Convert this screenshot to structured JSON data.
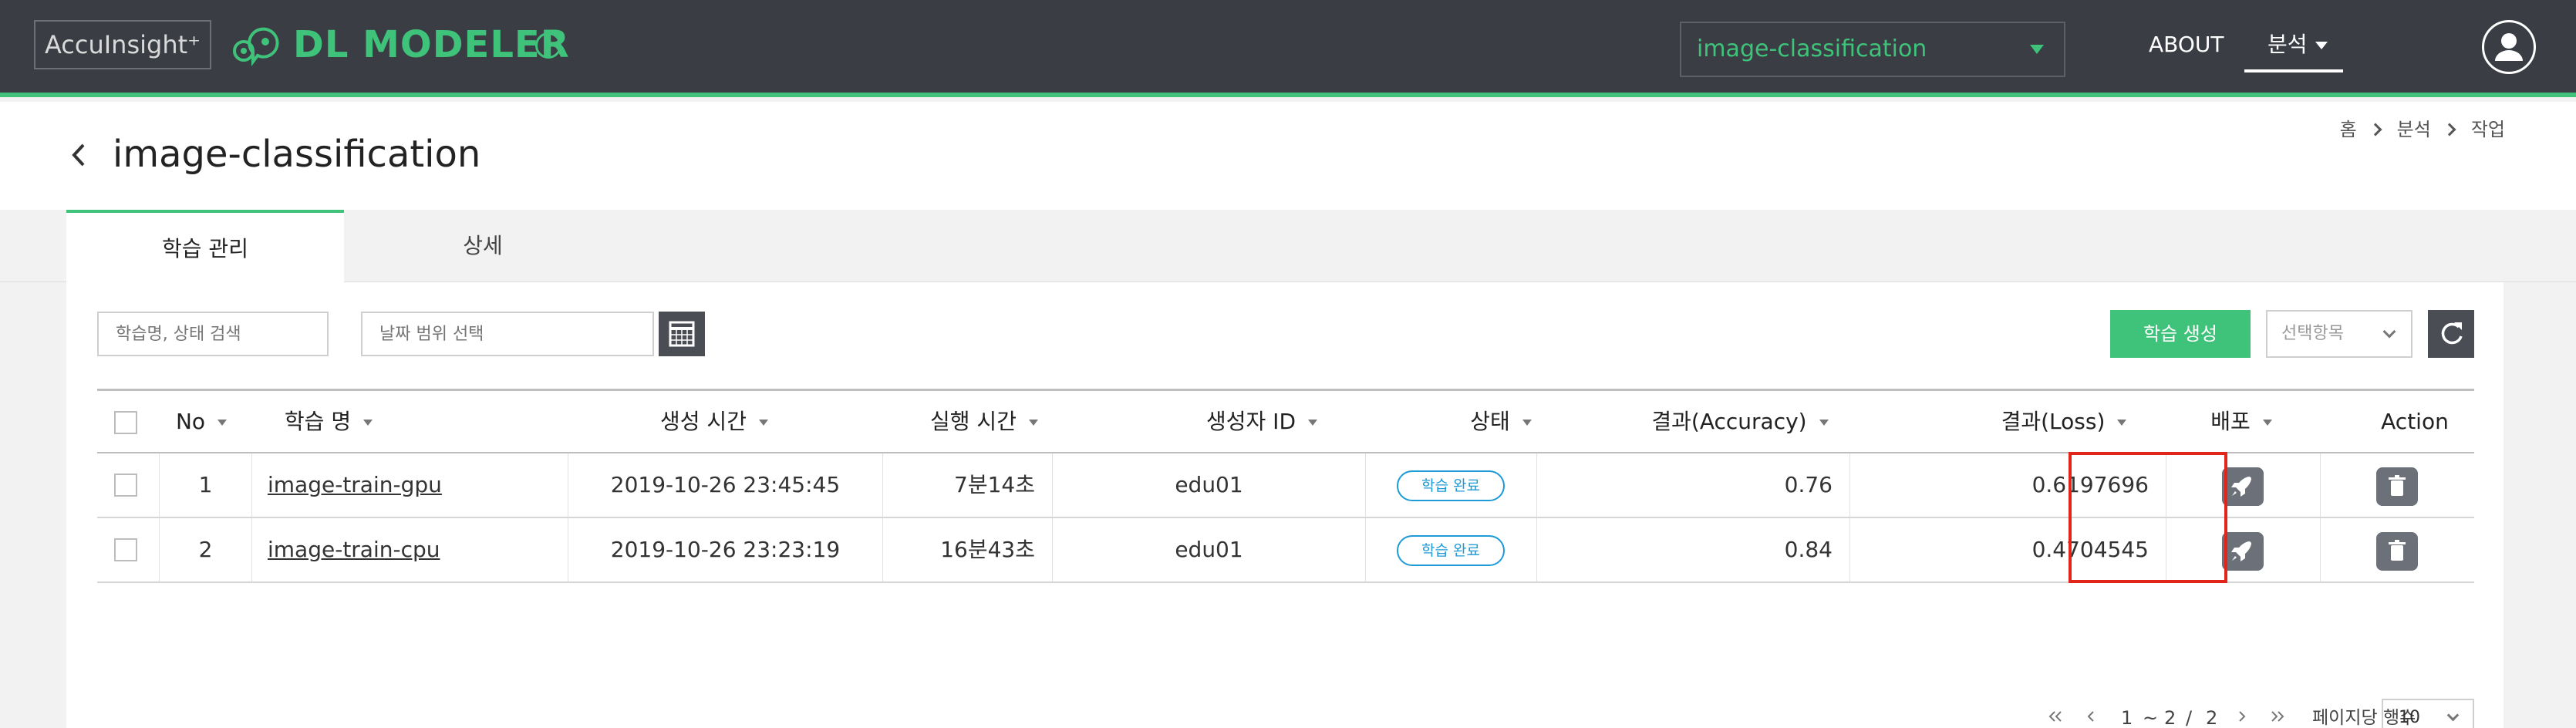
{
  "header": {
    "brand": "AccuInsight⁺",
    "product_name": "DL MODELER",
    "project_select": "image-classification",
    "nav_about": "ABOUT",
    "nav_analysis": "분석"
  },
  "titlebar": {
    "title": "image-classification",
    "breadcrumb": [
      "홈",
      "분석",
      "작업"
    ]
  },
  "tabs": [
    {
      "label": "학습 관리",
      "active": true
    },
    {
      "label": "상세",
      "active": false
    }
  ],
  "toolbar": {
    "search_placeholder": "학습명, 상태 검색",
    "date_placeholder": "날짜 범위 선택",
    "create_label": "학습 생성",
    "select_items_label": "선택항목"
  },
  "table": {
    "headers": {
      "no": "No",
      "name": "학습 명",
      "created": "생성 시간",
      "runtime": "실행 시간",
      "creator": "생성자 ID",
      "status": "상태",
      "accuracy": "결과(Accuracy)",
      "loss": "결과(Loss)",
      "deploy": "배포",
      "action": "Action"
    },
    "rows": [
      {
        "no": "1",
        "name": "image-train-gpu",
        "created": "2019-10-26 23:45:45",
        "runtime": "7분14초",
        "creator": "edu01",
        "status": "학습 완료",
        "accuracy": "0.76",
        "loss": "0.6197696"
      },
      {
        "no": "2",
        "name": "image-train-cpu",
        "created": "2019-10-26 23:23:19",
        "runtime": "16분43초",
        "creator": "edu01",
        "status": "학습 완료",
        "accuracy": "0.84",
        "loss": "0.4704545"
      }
    ]
  },
  "pagination": {
    "current": "1",
    "tilde": "~",
    "end": "2",
    "slash": "/",
    "total": "2",
    "rows_per_page_label": "페이지당 행수",
    "rows_per_page": "10"
  },
  "colors": {
    "accent": "#3fc27a",
    "header_bg": "#3a3d43",
    "status": "#1e9ad6",
    "highlight": "#e1251b"
  }
}
